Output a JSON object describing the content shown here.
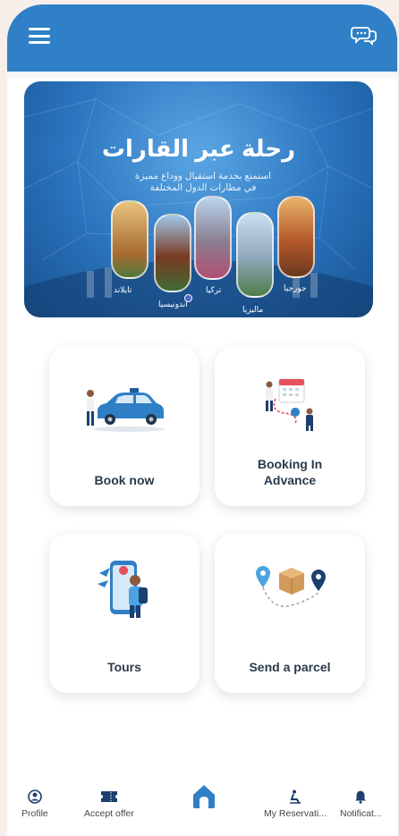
{
  "colors": {
    "primary": "#2f80c6",
    "navy": "#1b3f6e",
    "background": "#f7eeea",
    "card_text": "#2b3a4a"
  },
  "header": {
    "menu_icon": "hamburger-menu-icon",
    "chat_icon": "chat-bubbles-icon"
  },
  "banner": {
    "title": "رحلة عبر القارات",
    "subtitle_line1": "استمتع بخدمة استقبال ووداع مميزة",
    "subtitle_line2": "في مطارات الدول المختلفة",
    "destinations": [
      "تايلاند",
      "اندونيسيا",
      "تركيا",
      "ماليزيا",
      "جورجيا"
    ]
  },
  "services": [
    {
      "label": "Book now",
      "icon": "taxi-car-icon"
    },
    {
      "label_line1": "Booking In",
      "label_line2": "Advance",
      "icon": "calendar-route-icon"
    },
    {
      "label": "Tours",
      "icon": "tour-guide-phone-icon"
    },
    {
      "label": "Send a parcel",
      "icon": "parcel-route-icon"
    }
  ],
  "bottom_nav": {
    "profile": "Profile",
    "accept_offer": "Accept offer",
    "home_icon": "home-icon",
    "my_reservations": "My Reservati...",
    "notifications": "Notificat..."
  }
}
